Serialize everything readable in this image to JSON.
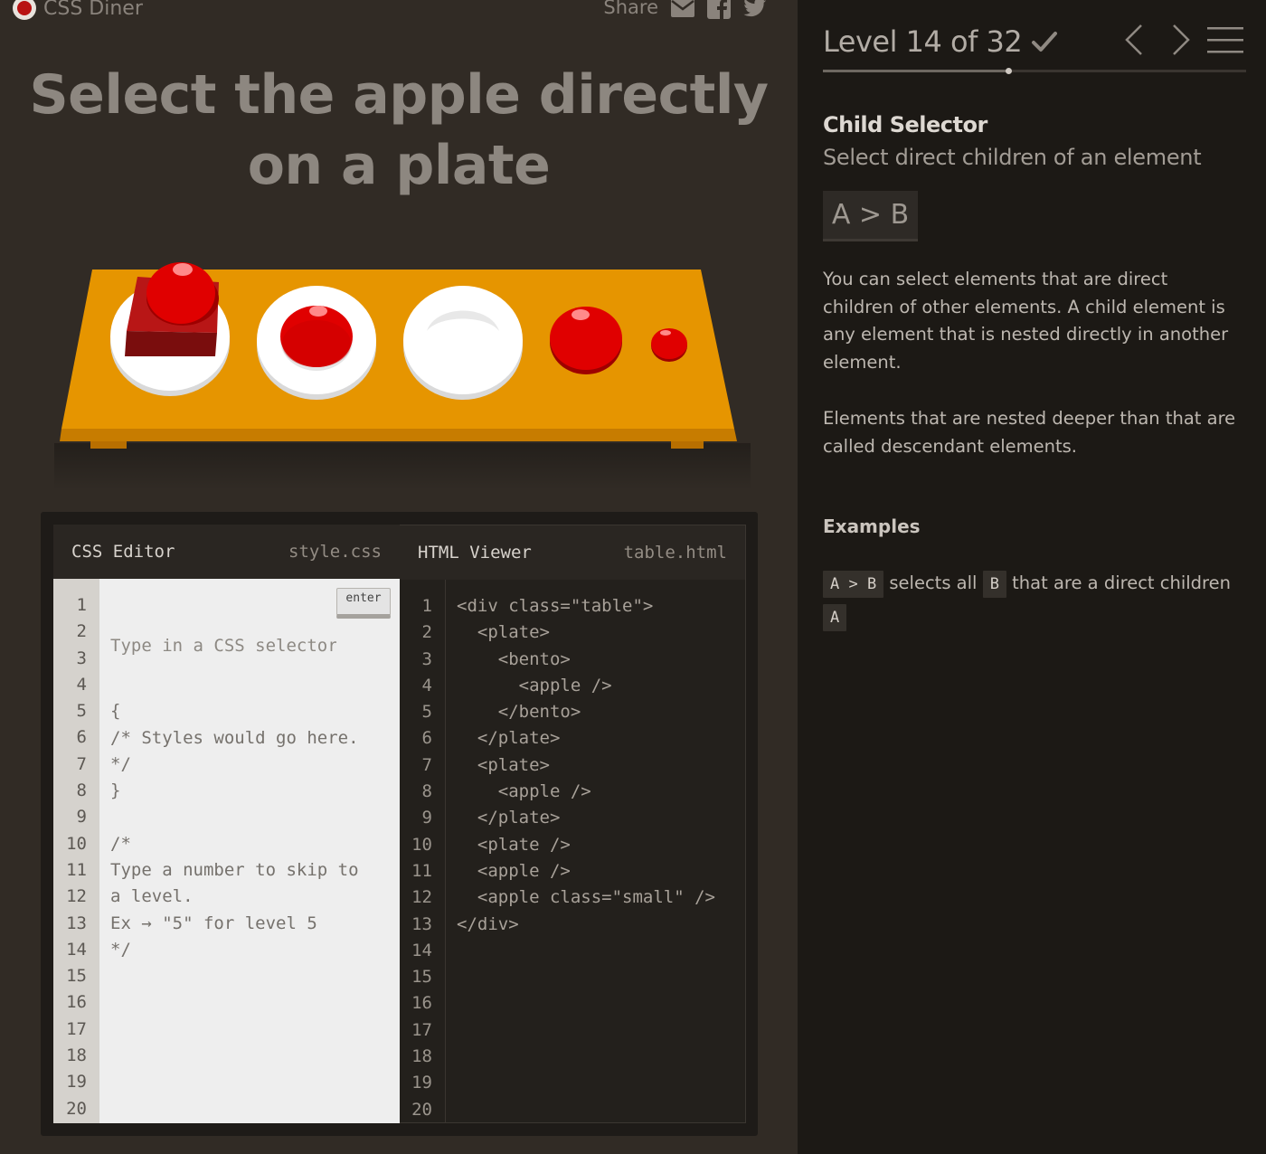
{
  "app": {
    "name": "CSS Diner"
  },
  "share": {
    "label": "Share"
  },
  "instruction": "Select the apple directly on a plate",
  "colors": {
    "table": "#e69500",
    "apple": "#e00000",
    "plate": "#ffffff",
    "bento": "#a01515"
  },
  "css_editor": {
    "title": "CSS Editor",
    "filename": "style.css",
    "placeholder": "Type in a CSS selector",
    "enter_label": "enter",
    "lines": [
      "",
      "{",
      "/* Styles would go here.",
      "*/",
      "}",
      "",
      "/*",
      "Type a number to skip to",
      "a level.",
      "Ex → \"5\" for level 5",
      "*/",
      "",
      "",
      "",
      "",
      "",
      "",
      "",
      "",
      ""
    ],
    "line_numbers": [
      "1",
      "2",
      "3",
      "4",
      "5",
      "6",
      "7",
      "8",
      "9",
      "10",
      "11",
      "12",
      "13",
      "14",
      "15",
      "16",
      "17",
      "18",
      "19",
      "20"
    ]
  },
  "html_viewer": {
    "title": "HTML Viewer",
    "filename": "table.html",
    "lines": [
      "<div class=\"table\">",
      "  <plate>",
      "    <bento>",
      "      <apple />",
      "    </bento>",
      "  </plate>",
      "  <plate>",
      "    <apple />",
      "  </plate>",
      "  <plate />",
      "  <apple />",
      "  <apple class=\"small\" />",
      "</div>",
      "",
      "",
      "",
      "",
      "",
      "",
      ""
    ],
    "line_numbers": [
      "1",
      "2",
      "3",
      "4",
      "5",
      "6",
      "7",
      "8",
      "9",
      "10",
      "11",
      "12",
      "13",
      "14",
      "15",
      "16",
      "17",
      "18",
      "19",
      "20"
    ]
  },
  "level": {
    "label": "Level 14 of 32",
    "current": 14,
    "total": 32,
    "completed": true
  },
  "selector": {
    "name": "Child Selector",
    "title": "Select direct children of an element",
    "syntax": "A > B",
    "hint_1": "You can select elements that are direct children of other elements. A child element is any element that is nested directly in another element.",
    "hint_2": "Elements that are nested deeper than that are called descendant elements."
  },
  "examples": {
    "title": "Examples",
    "items": [
      {
        "code": "A > B",
        "text_1": "selects all",
        "code_2": "B",
        "text_2": "that are a direct children",
        "code_3": "A"
      }
    ]
  },
  "icons": {
    "mail": "mail-icon",
    "facebook": "facebook-icon",
    "twitter": "twitter-icon",
    "check": "check-icon",
    "prev": "chevron-left-icon",
    "next": "chevron-right-icon",
    "menu": "menu-icon"
  }
}
